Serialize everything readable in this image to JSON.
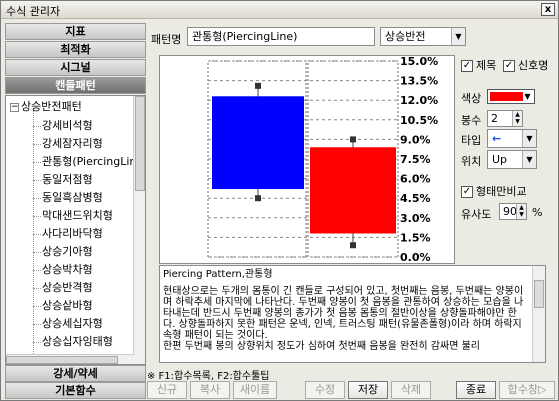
{
  "window": {
    "title": "수식 관리자",
    "close_glyph": "x"
  },
  "categories": [
    "지표",
    "최적화",
    "시그널",
    "캔들패턴"
  ],
  "bottom_categories": [
    "강세/약세",
    "기본함수"
  ],
  "tree": {
    "root": "상승반전패턴",
    "items": [
      "강세비석형",
      "강세잠자리형",
      "관통형(PiercingLine)",
      "동일저점형",
      "동일흑삼병형",
      "막대샌드위치형",
      "사다리바닥형",
      "상승기아형",
      "상승박차형",
      "상승반격형",
      "상승샅바형",
      "상승세십자형",
      "상승십자잉태형",
      "상승잉태형",
      "상승잉태형확인형"
    ]
  },
  "pattern": {
    "label": "패턴명",
    "name": "관통형(PiercingLine)",
    "type": "상승반전"
  },
  "chart_data": {
    "type": "bar",
    "title": "",
    "y_ticks": [
      "15.0%",
      "13.5%",
      "12.0%",
      "10.5%",
      "9.0%",
      "7.5%",
      "6.0%",
      "4.5%",
      "3.0%",
      "1.5%",
      "0.0%"
    ],
    "ylim": [
      0,
      15
    ],
    "candles": [
      {
        "name": "first",
        "color": "#0000ff",
        "open": 12.3,
        "close": 5.2,
        "high": 13.1,
        "low": 4.5
      },
      {
        "name": "second",
        "color": "#ff0000",
        "open": 1.8,
        "close": 8.4,
        "high": 9.0,
        "low": 0.9
      }
    ]
  },
  "options": {
    "title_check": "제목",
    "signal_check": "신호명",
    "color_label": "색상",
    "color_value": "#ff0000",
    "thickness_label": "봉수",
    "thickness_value": "2",
    "type_label": "타입",
    "type_value": "←",
    "position_label": "위치",
    "position_value": "Up",
    "compare_check": "형태만비교",
    "similarity_label": "유사도",
    "similarity_value": "90",
    "similarity_unit": "%"
  },
  "description": {
    "title": "Piercing Pattern,관통형",
    "lines": [
      "현태상으로는 두개의 몸통이 긴 캔들로 구성되어 있고, 첫번째는 음봉, 두번째는 양봉이며 하락추세 마지막에 나타난다. 두번째 양봉이 첫 음봉을 관통하여 상승하는 모습을 나타내는데 반드시 두번째 양봉의 종가가 첫 음봉 몸통의 절반이상을 상향돌파해야만 한다. 상향돌파하지 못한 패턴은 운넥, 인넥, 트러스팅 패턴(유물존폴형)이라 하며 하락지속형 패턴이 되는 것이다.",
      "한편 두번째 봉의 상향위치 정도가 심하여 첫번째 음봉을 완전히 감싸면 불리"
    ]
  },
  "hint": "※ F1:합수목록, F2:합수툴팁",
  "buttons": [
    {
      "label": "신규",
      "enabled": false
    },
    {
      "label": "복사",
      "enabled": false
    },
    {
      "label": "새이름",
      "enabled": false
    },
    {
      "label": "수정",
      "enabled": false
    },
    {
      "label": "저장",
      "enabled": true
    },
    {
      "label": "삭제",
      "enabled": false
    },
    {
      "label": "종료",
      "enabled": true
    },
    {
      "label": "합수창▷",
      "enabled": false
    }
  ]
}
